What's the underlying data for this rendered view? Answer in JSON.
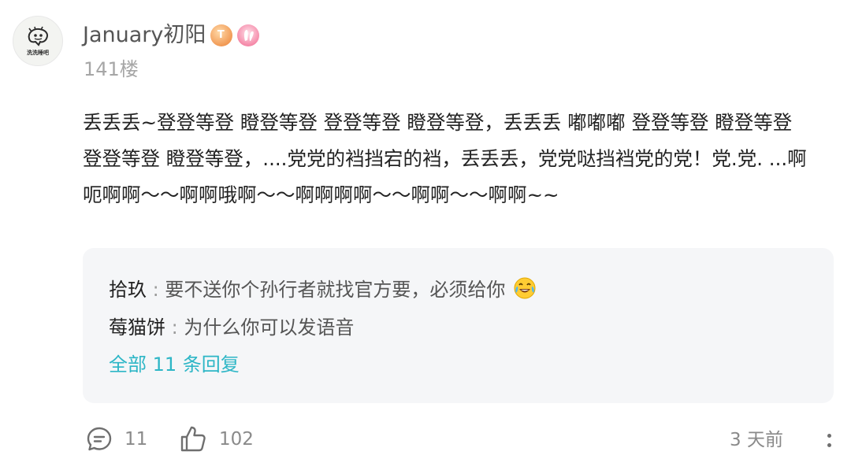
{
  "post": {
    "avatar_caption": "洗洗睡吧",
    "username": "January初阳",
    "level_badge": "T",
    "floor": "141楼",
    "content_lines": [
      "丢丢丢~登登等登 瞪登等登 登登等登 瞪登等登，丢丢丢 嘟嘟嘟 登登等登 瞪登等登",
      "登登等登 瞪登等登，....党党的裆挡宕的裆，丢丢丢，党党哒挡裆党的党！党.党. ...啊",
      "呃啊啊～～啊啊哦啊～～啊啊啊啊～～啊啊～～啊啊~~"
    ]
  },
  "replies": {
    "items": [
      {
        "author": "拾玖",
        "separator": ":",
        "text": "要不送你个孙行者就找官方要，必须给你",
        "emoji": "laugh-cry-emoji"
      },
      {
        "author": "莓猫饼",
        "separator": ":",
        "text": "为什么你可以发语音"
      }
    ],
    "view_all": "全部 11 条回复"
  },
  "footer": {
    "comment_count": "11",
    "like_count": "102",
    "time": "3 天前"
  },
  "colors": {
    "link": "#2db6c6",
    "muted": "#a6a6a6",
    "reply_bg": "#f5f6f8"
  }
}
